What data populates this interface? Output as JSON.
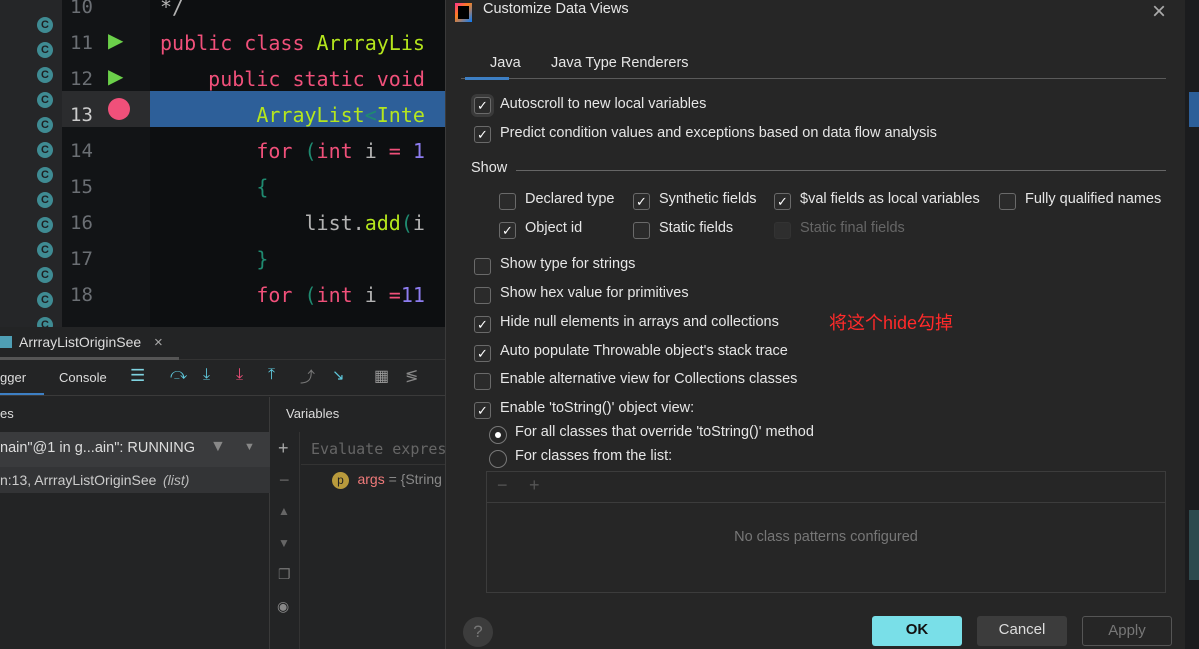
{
  "editor": {
    "lines": [
      {
        "num": "10",
        "tokens": [
          {
            "t": "*/",
            "c": "id"
          }
        ]
      },
      {
        "num": "11",
        "tokens": [
          {
            "t": "public class ",
            "c": "kw"
          },
          {
            "t": "ArrrayLis",
            "c": "ty"
          }
        ]
      },
      {
        "num": "12",
        "tokens": [
          {
            "t": "    public static void",
            "c": "kw"
          }
        ]
      },
      {
        "num": "13",
        "tokens": [
          {
            "t": "        ArrayList",
            "c": "ty"
          },
          {
            "t": "<",
            "c": "pn"
          },
          {
            "t": "Inte",
            "c": "ty"
          }
        ]
      },
      {
        "num": "14",
        "tokens": [
          {
            "t": "        for ",
            "c": "kw"
          },
          {
            "t": "(",
            "c": "pn"
          },
          {
            "t": "int ",
            "c": "kw"
          },
          {
            "t": "i",
            "c": "id"
          },
          {
            "t": " = ",
            "c": "kw"
          },
          {
            "t": "1",
            "c": "nm"
          }
        ]
      },
      {
        "num": "15",
        "tokens": [
          {
            "t": "        {",
            "c": "pn"
          }
        ]
      },
      {
        "num": "16",
        "tokens": [
          {
            "t": "            list.",
            "c": "id"
          },
          {
            "t": "add",
            "c": "ty"
          },
          {
            "t": "(",
            "c": "pn"
          },
          {
            "t": "i",
            "c": "id"
          }
        ]
      },
      {
        "num": "17",
        "tokens": [
          {
            "t": "        }",
            "c": "pn"
          }
        ]
      },
      {
        "num": "18",
        "tokens": [
          {
            "t": "        for ",
            "c": "kw"
          },
          {
            "t": "(",
            "c": "pn"
          },
          {
            "t": "int ",
            "c": "kw"
          },
          {
            "t": "i",
            "c": "id"
          },
          {
            "t": " =",
            "c": "kw"
          },
          {
            "t": "11",
            "c": "nm"
          }
        ]
      }
    ],
    "current_line": "13"
  },
  "debug": {
    "run_tab": "ArrrayListOriginSee",
    "tabs": [
      "gger",
      "Console"
    ],
    "frames_header": "es",
    "variables_header": "Variables",
    "thread": "nain\"@1 in g...ain\": RUNNING",
    "frame": "n:13, ArrrayListOriginSee",
    "frame_extra": "(list)",
    "evaluate_placeholder": "Evaluate expres",
    "var_name": "args",
    "var_value": " = {String",
    "var_badge": "p"
  },
  "dialog": {
    "title": "Customize Data Views",
    "tabs": [
      "Java",
      "Java Type Renderers"
    ],
    "active_tab": "Java",
    "autoscroll": {
      "label": "Autoscroll to new local variables",
      "checked": true
    },
    "predict": {
      "label": "Predict condition values and exceptions based on data flow analysis",
      "checked": true
    },
    "show_label": "Show",
    "show": [
      {
        "label": "Declared type",
        "checked": false
      },
      {
        "label": "Synthetic fields",
        "checked": true
      },
      {
        "label": "$val fields as local variables",
        "checked": true
      },
      {
        "label": "Fully qualified names",
        "checked": false
      },
      {
        "label": "Object id",
        "checked": true
      },
      {
        "label": "Static fields",
        "checked": false
      },
      {
        "label": "Static final fields",
        "checked": false,
        "disabled": true
      }
    ],
    "options": [
      {
        "label": "Show type for strings",
        "checked": false
      },
      {
        "label": "Show hex value for primitives",
        "checked": false
      },
      {
        "label": "Hide null elements in arrays and collections",
        "checked": true
      },
      {
        "label": "Auto populate Throwable object's stack trace",
        "checked": true
      },
      {
        "label": "Enable alternative view for Collections classes",
        "checked": false
      },
      {
        "label": "Enable 'toString()' object view:",
        "checked": true
      }
    ],
    "annotation": "将这个hide勾掉",
    "annotation_color": "#ff2a2a",
    "radios": [
      {
        "label": "For all classes that override 'toString()' method",
        "selected": true
      },
      {
        "label": "For classes from the list:",
        "selected": false
      }
    ],
    "empty_list": "No class patterns configured",
    "buttons": {
      "ok": "OK",
      "cancel": "Cancel",
      "apply": "Apply",
      "help": "?"
    },
    "accent": "#79dfe8"
  }
}
